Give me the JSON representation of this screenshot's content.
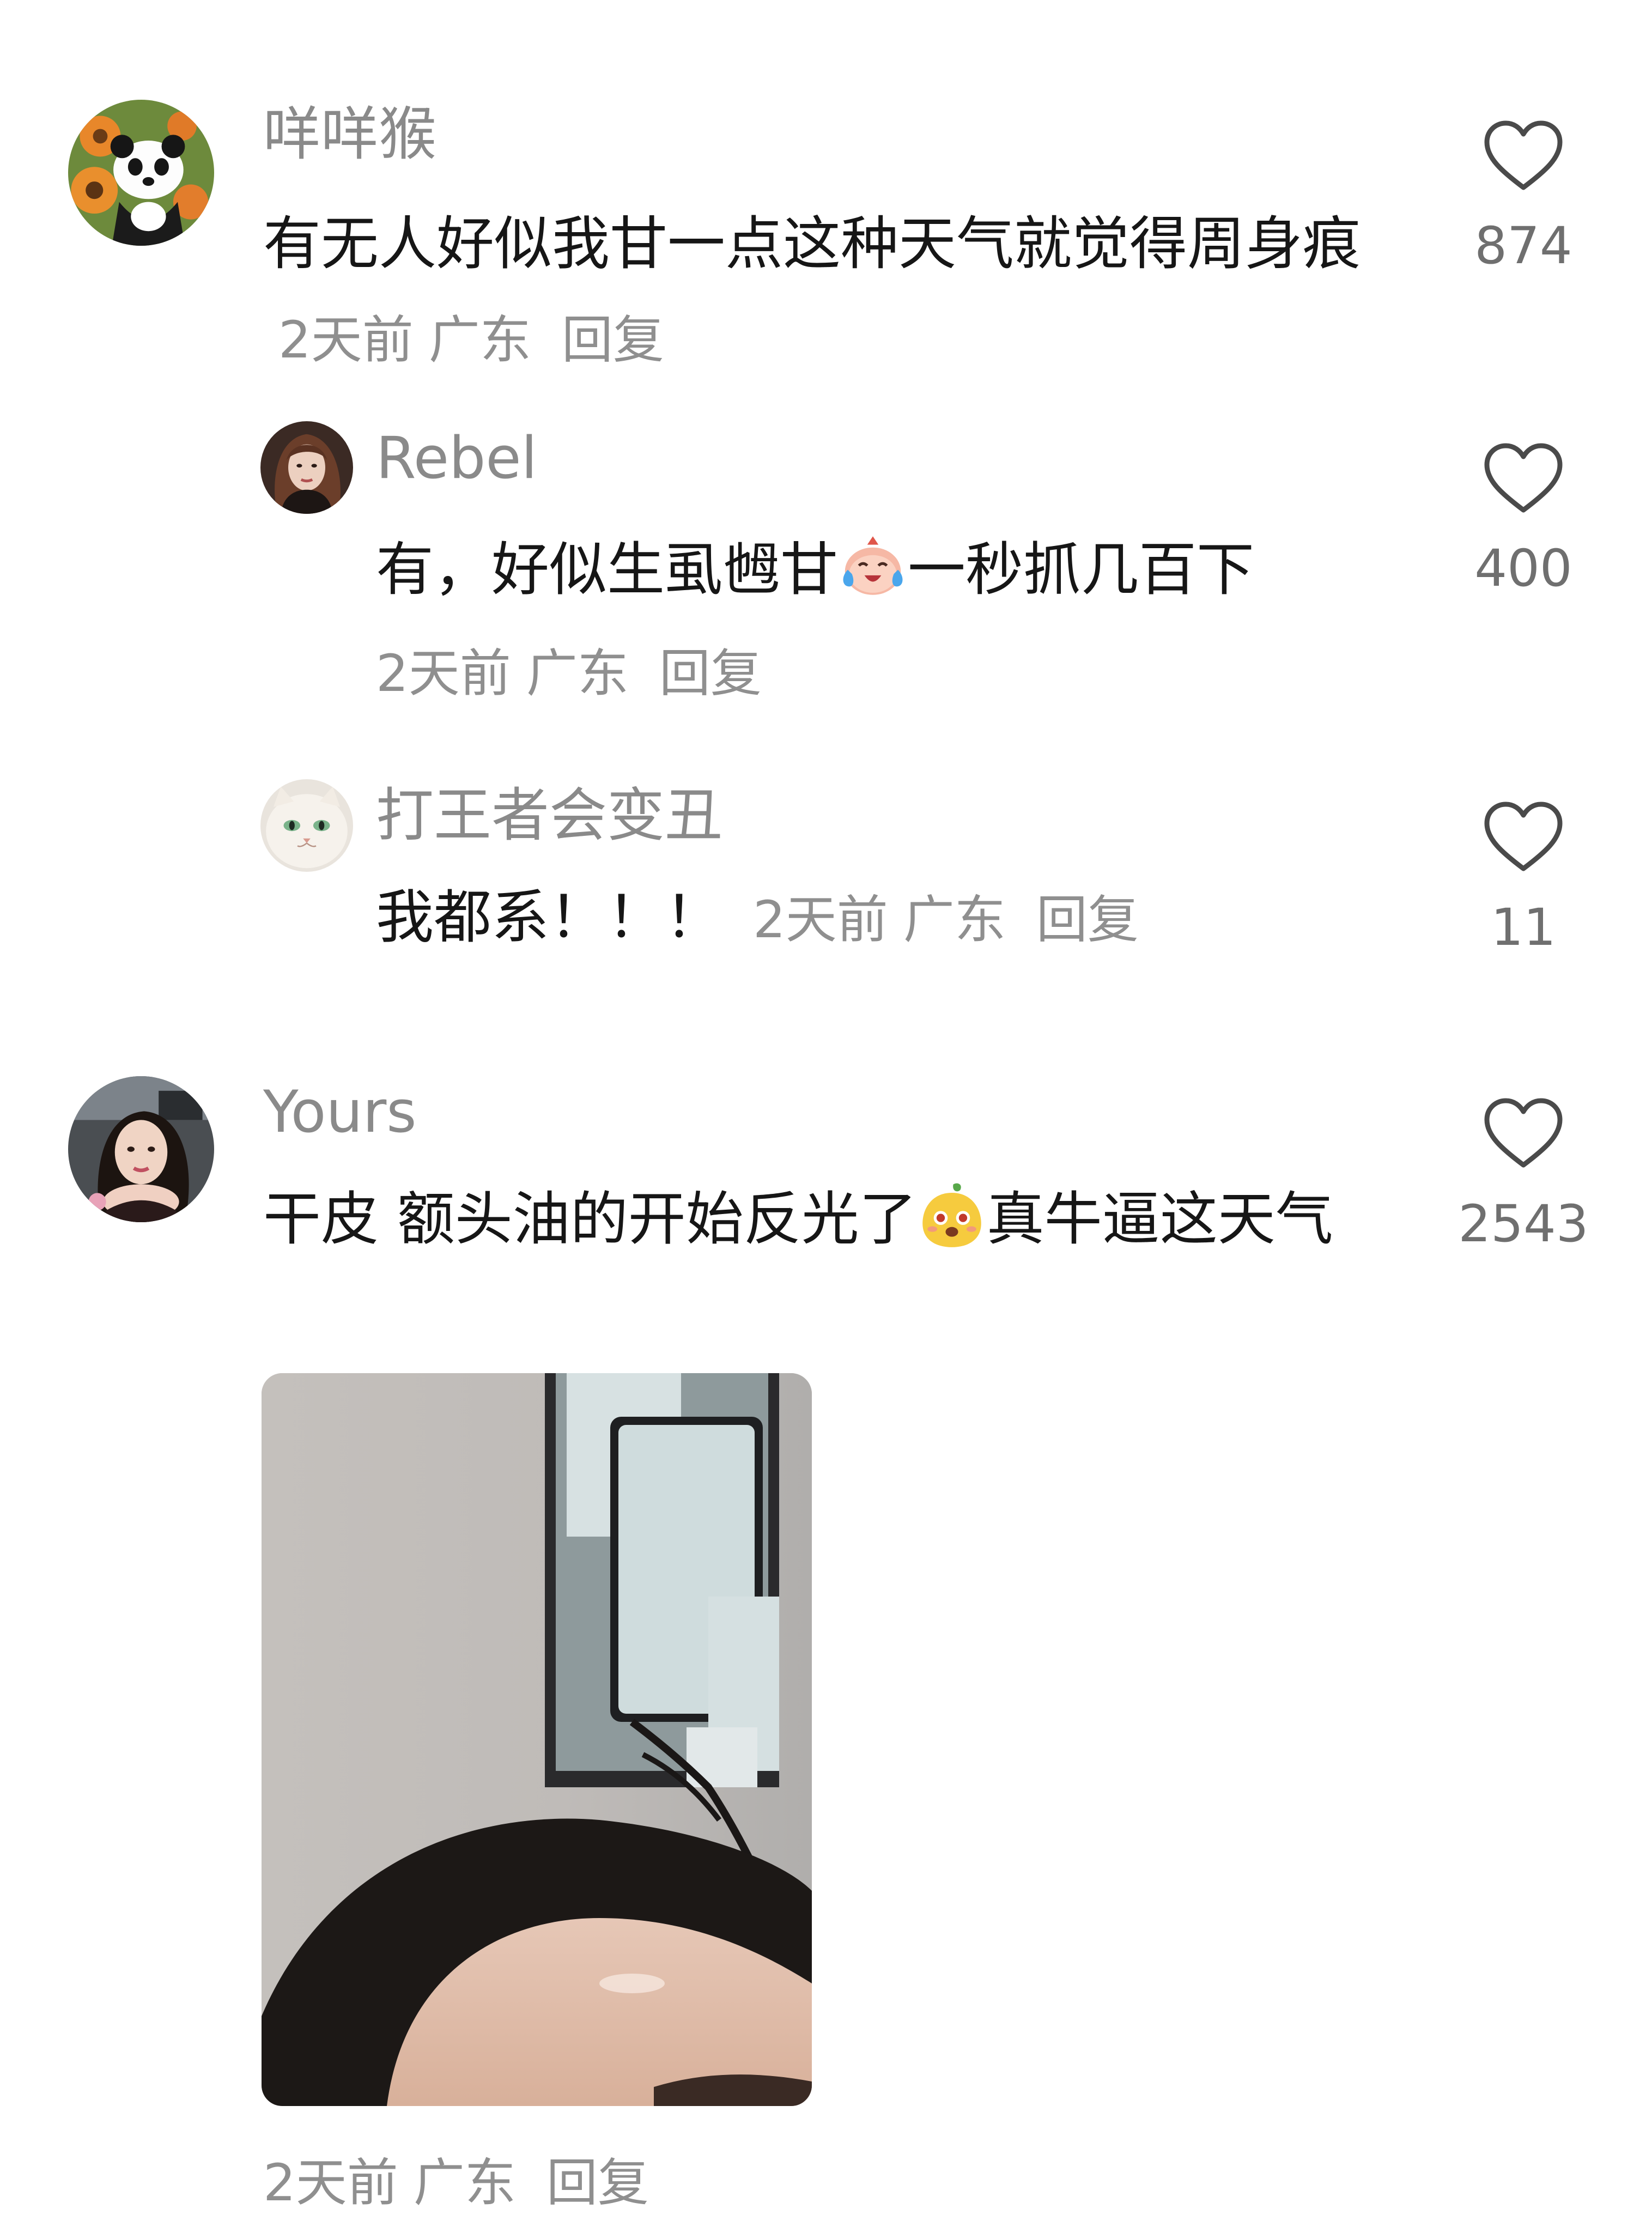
{
  "comments": [
    {
      "username": "咩咩猴",
      "text": "有无人好似我甘一点这种天气就觉得周身痕",
      "time": "2天前",
      "location": "广东",
      "reply_label": "回复",
      "likes": "874",
      "avatar_icon": "panda-avatar"
    },
    {
      "username": "Rebel",
      "text_before_emoji": "有，好似生虱乸甘",
      "emoji": "crying-laughing-emoji",
      "text_after_emoji": "一秒抓几百下",
      "time": "2天前",
      "location": "广东",
      "reply_label": "回复",
      "likes": "400",
      "avatar_icon": "woman-portrait-avatar"
    },
    {
      "username": "打王者会变丑",
      "text": "我都系！！！",
      "time": "2天前",
      "location": "广东",
      "reply_label": "回复",
      "likes": "11",
      "avatar_icon": "white-cat-avatar"
    },
    {
      "username": "Yours",
      "text_before_emoji": "干皮 额头油的开始反光了",
      "emoji": "dazed-face-emoji",
      "text_after_emoji": "真牛逼这天气",
      "time": "2天前",
      "location": "广东",
      "reply_label": "回复",
      "likes": "2543",
      "avatar_icon": "woman-selfie-avatar",
      "attachment": "forehead-selfie-photo"
    }
  ],
  "colors": {
    "username": "#8a8a8a",
    "text": "#161616",
    "meta": "#8f8f8f",
    "like_count": "#6f6f6f"
  }
}
